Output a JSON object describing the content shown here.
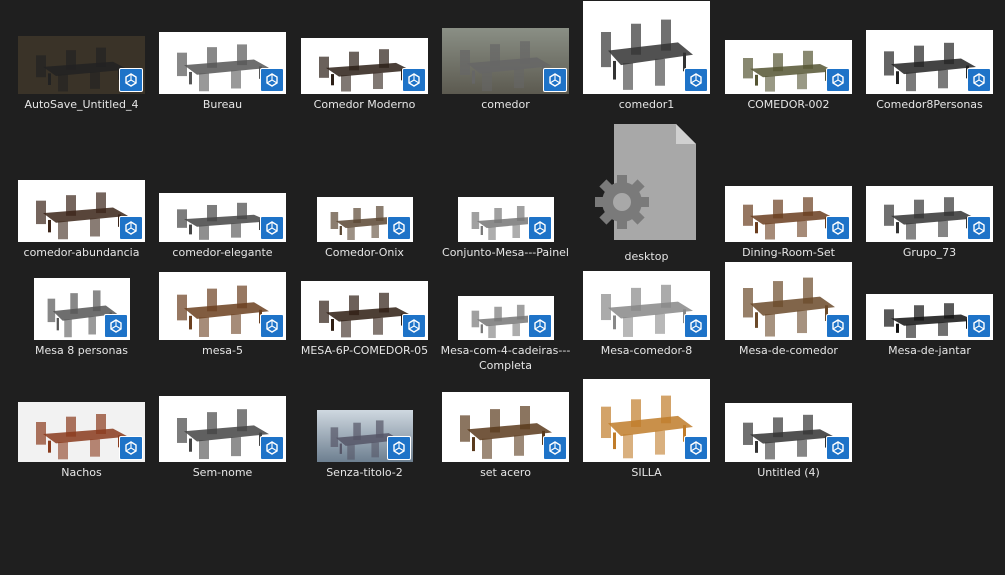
{
  "files": [
    {
      "name": "AutoSave_Untitled_4",
      "style": "dark"
    },
    {
      "name": "Bureau",
      "style": "white"
    },
    {
      "name": "Comedor Moderno",
      "style": "white"
    },
    {
      "name": "comedor",
      "style": "photo"
    },
    {
      "name": "comedor1",
      "style": "white"
    },
    {
      "name": "COMEDOR-002",
      "style": "white"
    },
    {
      "name": "Comedor8Personas",
      "style": "white"
    },
    {
      "name": "comedor-abundancia",
      "style": "white"
    },
    {
      "name": "comedor-elegante",
      "style": "white"
    },
    {
      "name": "Comedor-Onix",
      "style": "white"
    },
    {
      "name": "Conjunto-Mesa---Painel",
      "style": "white"
    },
    {
      "name": "desktop",
      "style": "generic"
    },
    {
      "name": "Dining-Room-Set",
      "style": "white"
    },
    {
      "name": "Grupo_73",
      "style": "white"
    },
    {
      "name": "Mesa 8 personas",
      "style": "white"
    },
    {
      "name": "mesa-5",
      "style": "white"
    },
    {
      "name": "MESA-6P-COMEDOR-05",
      "style": "white"
    },
    {
      "name": "Mesa-com-4-cadeiras---Completa",
      "style": "white"
    },
    {
      "name": "Mesa-comedor-8",
      "style": "white"
    },
    {
      "name": "Mesa-de-comedor",
      "style": "white"
    },
    {
      "name": "Mesa-de-jantar",
      "style": "white"
    },
    {
      "name": "Nachos",
      "style": "food"
    },
    {
      "name": "Sem-nome",
      "style": "white"
    },
    {
      "name": "Senza-titolo-2",
      "style": "city"
    },
    {
      "name": "set acero",
      "style": "white"
    },
    {
      "name": "SILLA",
      "style": "white"
    },
    {
      "name": "Untitled (4)",
      "style": "white"
    }
  ],
  "icons": {
    "file_badge": "sketchup-icon",
    "generic_file": "settings-file-icon"
  },
  "colors": {
    "background": "#1f1f1f",
    "badge": "#1e73c8",
    "text": "#e6e6e6"
  }
}
